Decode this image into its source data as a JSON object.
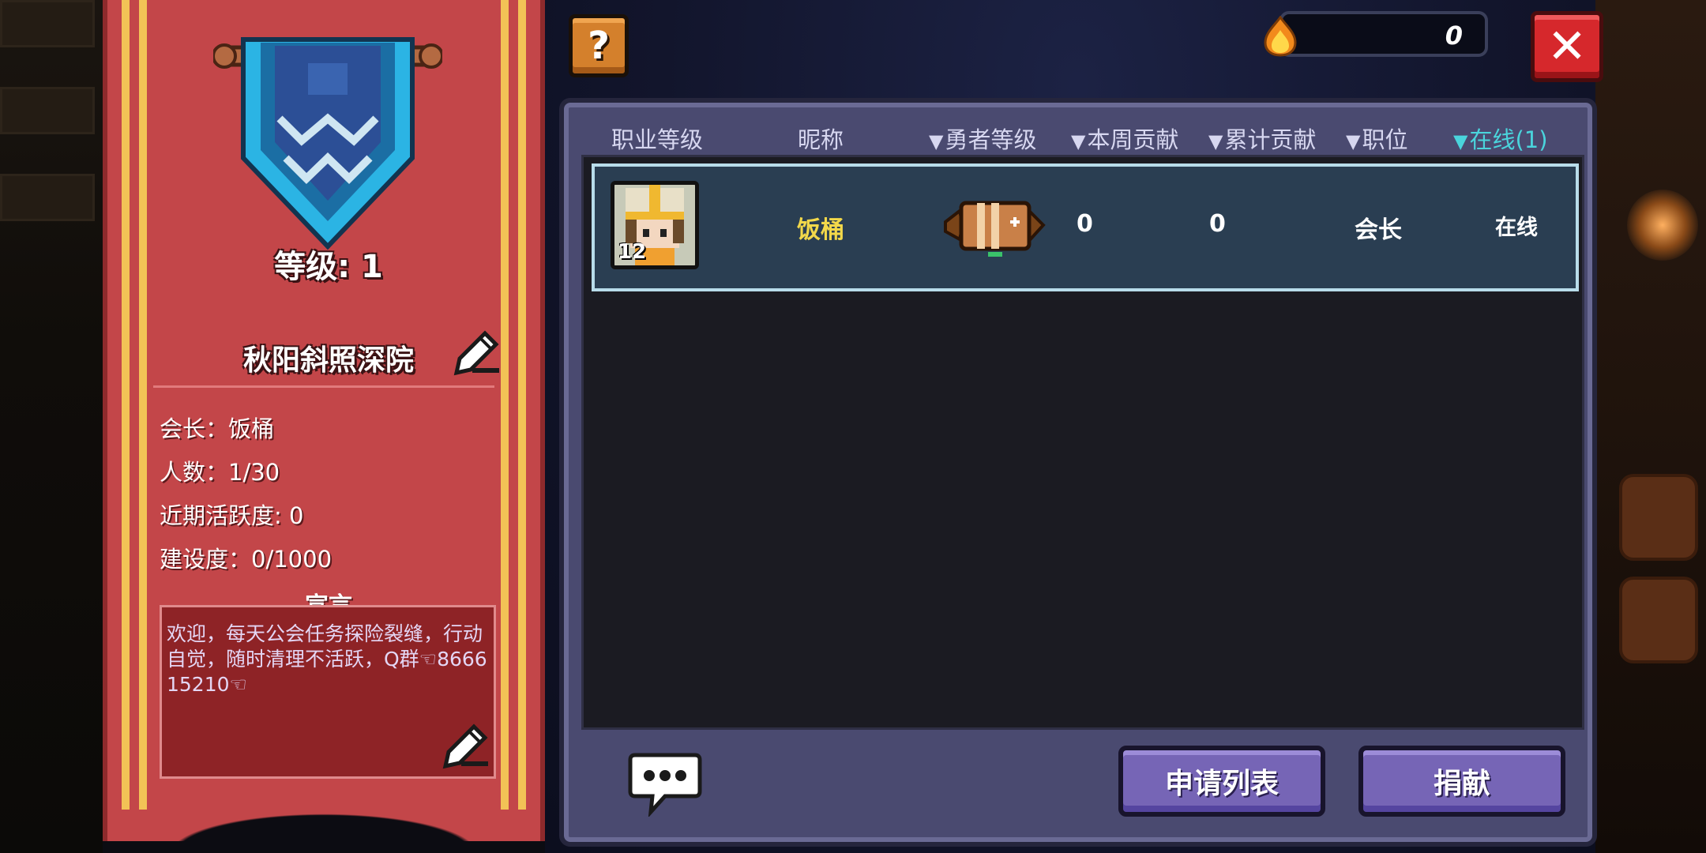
{
  "guild": {
    "level_label": "等级: 1",
    "name": "秋阳斜照深院",
    "leader_line": "会长：饭桶",
    "members_line": "人数：1/30",
    "activity_line": "近期活跃度: 0",
    "construction_line": "建设度：0/1000",
    "declaration_title": "宣言",
    "declaration_text": "欢迎，每天公会任务探险裂缝，行动自觉，随时清理不活跃，Q群☜866615210☜"
  },
  "topbar": {
    "help_label": "?",
    "currency_value": "0",
    "close_label": "✕"
  },
  "table": {
    "headers": [
      {
        "label": "职业等级",
        "sortable": false,
        "selected": false
      },
      {
        "label": "昵称",
        "sortable": false,
        "selected": false
      },
      {
        "label": "勇者等级",
        "sortable": true,
        "selected": false
      },
      {
        "label": "本周贡献",
        "sortable": true,
        "selected": false
      },
      {
        "label": "累计贡献",
        "sortable": true,
        "selected": false
      },
      {
        "label": "职位",
        "sortable": true,
        "selected": false
      },
      {
        "label": "在线(1)",
        "sortable": true,
        "selected": true
      }
    ],
    "sort_arrow": "▼",
    "rows": [
      {
        "job_level": "12",
        "nickname": "饭桶",
        "weekly_contribution": "0",
        "total_contribution": "0",
        "position": "会长",
        "status": "在线"
      }
    ]
  },
  "buttons": {
    "apply_list": "申请列表",
    "donate": "捐献"
  },
  "colors": {
    "banner_red": "#c34649",
    "panel_purple": "#4a4a70",
    "nickname_yellow": "#f2d84a",
    "selected_header": "#4ad4dc",
    "button_purple": "#7665b6",
    "close_red": "#d6282c",
    "help_orange": "#d4802c"
  },
  "icons": {
    "emblem": "guild-pennant-icon",
    "edit": "pencil-icon",
    "currency": "flame-icon",
    "chat": "speech-bubble-icon",
    "hero_level": "winged-badge-icon",
    "avatar": "knight-avatar-icon"
  }
}
